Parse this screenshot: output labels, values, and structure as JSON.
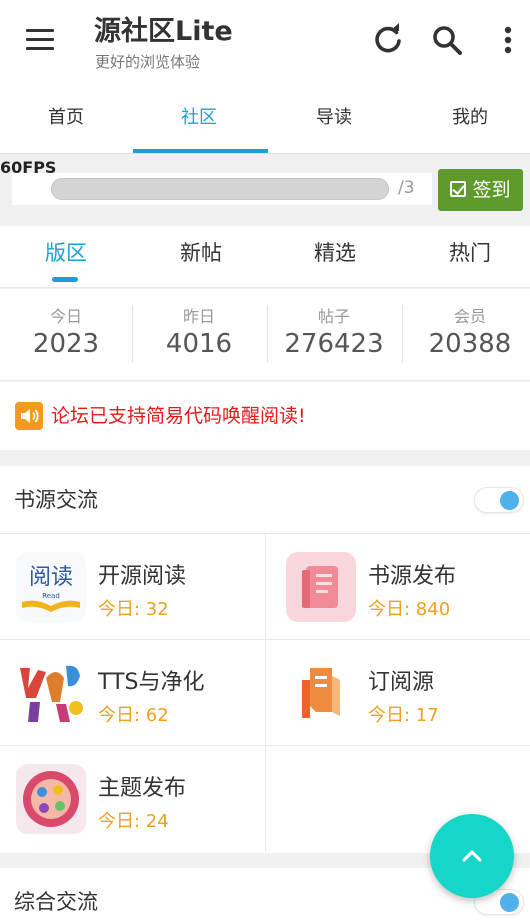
{
  "app": {
    "title": "源社区Lite",
    "subtitle": "更好的浏览体验"
  },
  "icons": {
    "menu": "hamburger-menu-icon",
    "refresh": "refresh-icon",
    "search": "search-icon",
    "more": "more-vertical-icon",
    "notice": "speaker-icon",
    "fab": "chevron-up-icon"
  },
  "colors": {
    "accent": "#1a9fd6",
    "signin": "#5e9a2b",
    "notice": "#e31b1b",
    "today": "#f0a020",
    "fab": "#16d5c9"
  },
  "top_tabs": [
    {
      "label": "首页"
    },
    {
      "label": "社区"
    },
    {
      "label": "导读"
    },
    {
      "label": "我的"
    }
  ],
  "active_top_tab": "社区",
  "fps": "60FPS",
  "checkin": {
    "progress_fraction": 0.0,
    "total_label": "/3",
    "button_label": "签到"
  },
  "sub_tabs": [
    {
      "label": "版区"
    },
    {
      "label": "新帖"
    },
    {
      "label": "精选"
    },
    {
      "label": "热门"
    }
  ],
  "active_sub_tab": "版区",
  "stats": [
    {
      "label": "今日",
      "value": "2023"
    },
    {
      "label": "昨日",
      "value": "4016"
    },
    {
      "label": "帖子",
      "value": "276423"
    },
    {
      "label": "会员",
      "value": "20388"
    }
  ],
  "notice": "论坛已支持简易代码唤醒阅读!",
  "sections": [
    {
      "title": "书源交流",
      "toggle_on": true,
      "forums": [
        {
          "name": "开源阅读",
          "today": "今日: 32",
          "icon": "read-app-icon"
        },
        {
          "name": "书源发布",
          "today": "今日: 840",
          "icon": "book-publish-icon"
        },
        {
          "name": "TTS与净化",
          "today": "今日: 62",
          "icon": "tts-letters-icon"
        },
        {
          "name": "订阅源",
          "today": "今日: 17",
          "icon": "subscription-icon"
        },
        {
          "name": "主题发布",
          "today": "今日: 24",
          "icon": "theme-palette-icon"
        }
      ]
    },
    {
      "title": "综合交流",
      "toggle_on": true
    }
  ]
}
